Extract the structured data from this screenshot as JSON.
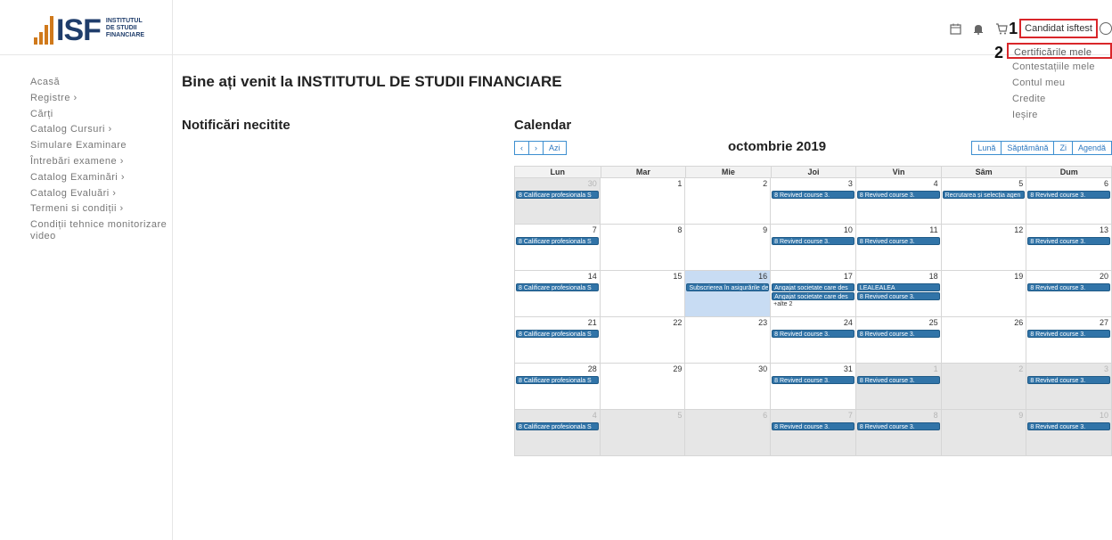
{
  "logo": {
    "mark": "ISF",
    "line1": "INSTITUTUL",
    "line2": "DE STUDII",
    "line3": "FINANCIARE"
  },
  "header": {
    "annotation_1": "1",
    "user_name": "Candidat isftest",
    "icons": [
      "calendar-icon",
      "bell-icon",
      "cart-icon",
      "user-circle-icon"
    ]
  },
  "dropdown": {
    "annotation_2": "2",
    "items": [
      "Certificările mele",
      "Contestațiile mele",
      "Contul meu",
      "Credite",
      "Ieșire"
    ]
  },
  "sidebar": {
    "items": [
      "Acasă",
      "Registre  ›",
      "Cărți",
      "Catalog Cursuri  ›",
      "Simulare Examinare",
      "Întrebări examene  ›",
      "Catalog Examinări  ›",
      "Catalog Evaluări  ›",
      "Termeni si condiții  ›",
      "Condiții tehnice monitorizare video"
    ]
  },
  "main": {
    "title": "Bine ați venit la INSTITUTUL DE STUDII FINANCIARE",
    "notifications_title": "Notificări necitite",
    "calendar_title": "Calendar"
  },
  "calendar": {
    "nav": {
      "prev": "‹",
      "next": "›",
      "today": "Azi"
    },
    "month_label": "octombrie 2019",
    "views": [
      "Lună",
      "Săptămână",
      "Zi",
      "Agendă"
    ],
    "weekdays": [
      "Lun",
      "Mar",
      "Mie",
      "Joi",
      "Vin",
      "Sâm",
      "Dum"
    ],
    "weeks": [
      [
        {
          "day": "30",
          "other": true,
          "events": [
            "8 Calificare profesionala S"
          ]
        },
        {
          "day": "1",
          "events": []
        },
        {
          "day": "2",
          "events": []
        },
        {
          "day": "3",
          "events": [
            "8 Revived course 3."
          ]
        },
        {
          "day": "4",
          "events": [
            "8 Revived course 3."
          ]
        },
        {
          "day": "5",
          "events": [
            "Recrutarea și selecția agen"
          ]
        },
        {
          "day": "6",
          "events": [
            "8 Revived course 3."
          ]
        }
      ],
      [
        {
          "day": "7",
          "events": [
            "8 Calificare profesionala S"
          ]
        },
        {
          "day": "8",
          "events": []
        },
        {
          "day": "9",
          "events": []
        },
        {
          "day": "10",
          "events": [
            "8 Revived course 3."
          ]
        },
        {
          "day": "11",
          "events": [
            "8 Revived course 3."
          ]
        },
        {
          "day": "12",
          "events": []
        },
        {
          "day": "13",
          "events": [
            "8 Revived course 3."
          ]
        }
      ],
      [
        {
          "day": "14",
          "events": [
            "8 Calificare profesionala S"
          ]
        },
        {
          "day": "15",
          "events": []
        },
        {
          "day": "16",
          "today": true,
          "events": [
            "Subscrierea în asigurările de"
          ]
        },
        {
          "day": "17",
          "events": [
            "Angajat societate care des",
            "Angajat societate care des"
          ],
          "more": "+alte 2"
        },
        {
          "day": "18",
          "events": [
            "LEALEALEA",
            "8 Revived course 3."
          ]
        },
        {
          "day": "19",
          "events": []
        },
        {
          "day": "20",
          "events": [
            "8 Revived course 3."
          ]
        }
      ],
      [
        {
          "day": "21",
          "events": [
            "8 Calificare profesionala S"
          ]
        },
        {
          "day": "22",
          "events": []
        },
        {
          "day": "23",
          "events": []
        },
        {
          "day": "24",
          "events": [
            "8 Revived course 3."
          ]
        },
        {
          "day": "25",
          "events": [
            "8 Revived course 3."
          ]
        },
        {
          "day": "26",
          "events": []
        },
        {
          "day": "27",
          "events": [
            "8 Revived course 3."
          ]
        }
      ],
      [
        {
          "day": "28",
          "events": [
            "8 Calificare profesionala S"
          ]
        },
        {
          "day": "29",
          "events": []
        },
        {
          "day": "30",
          "events": []
        },
        {
          "day": "31",
          "events": [
            "8 Revived course 3."
          ]
        },
        {
          "day": "1",
          "other": true,
          "events": [
            "8 Revived course 3."
          ]
        },
        {
          "day": "2",
          "other": true,
          "events": []
        },
        {
          "day": "3",
          "other": true,
          "events": [
            "8 Revived course 3."
          ]
        }
      ],
      [
        {
          "day": "4",
          "other": true,
          "events": [
            "8 Calificare profesionala S"
          ]
        },
        {
          "day": "5",
          "other": true,
          "events": []
        },
        {
          "day": "6",
          "other": true,
          "events": []
        },
        {
          "day": "7",
          "other": true,
          "events": [
            "8 Revived course 3."
          ]
        },
        {
          "day": "8",
          "other": true,
          "events": [
            "8 Revived course 3."
          ]
        },
        {
          "day": "9",
          "other": true,
          "events": []
        },
        {
          "day": "10",
          "other": true,
          "events": [
            "8 Revived course 3."
          ]
        }
      ]
    ]
  }
}
